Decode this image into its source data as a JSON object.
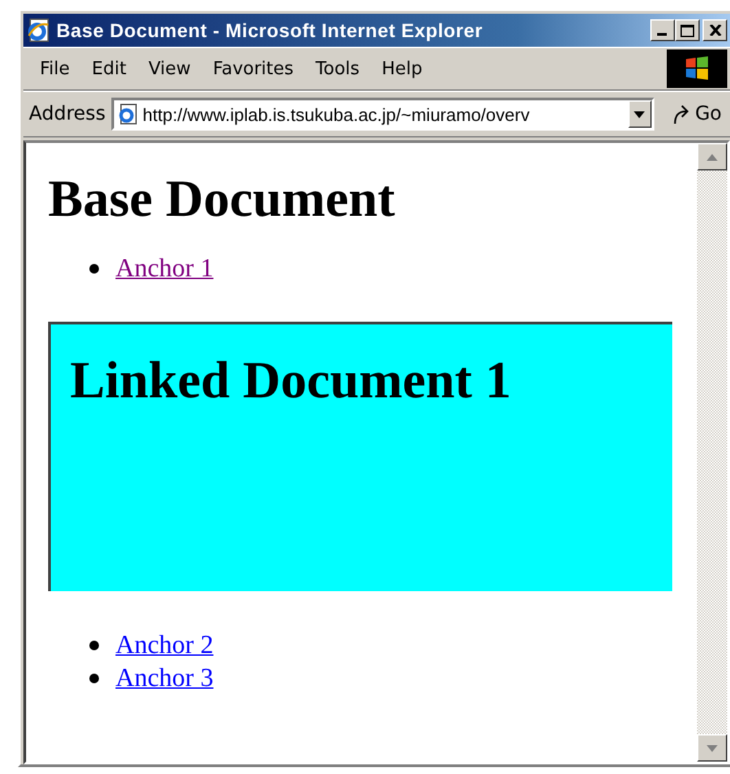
{
  "window": {
    "title": "Base Document - Microsoft Internet Explorer"
  },
  "menu": [
    "File",
    "Edit",
    "View",
    "Favorites",
    "Tools",
    "Help"
  ],
  "address": {
    "label": "Address",
    "value": "http://www.iplab.is.tsukuba.ac.jp/~miuramo/overv",
    "go": "Go"
  },
  "page": {
    "heading": "Base Document",
    "links_top": [
      {
        "label": "Anchor 1",
        "visited": true
      }
    ],
    "frame": {
      "heading": "Linked Document 1"
    },
    "links_bottom": [
      {
        "label": "Anchor 2",
        "visited": false
      },
      {
        "label": "Anchor 3",
        "visited": false
      }
    ]
  }
}
